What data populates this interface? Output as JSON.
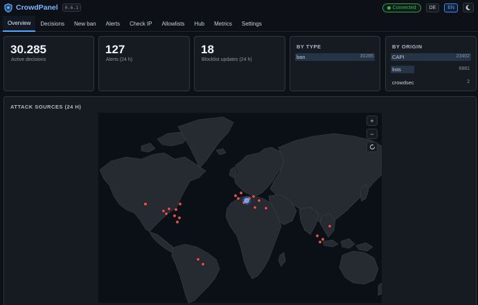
{
  "header": {
    "title": "CrowdPanel",
    "version": "0.6.1",
    "status": "Connected",
    "languages": [
      "DE",
      "EN"
    ],
    "active_language": "EN",
    "theme_icon": "moon-icon"
  },
  "tabs": [
    {
      "label": "Overview",
      "active": true
    },
    {
      "label": "Decisions"
    },
    {
      "label": "New ban"
    },
    {
      "label": "Alerts"
    },
    {
      "label": "Check IP"
    },
    {
      "label": "Allowlists"
    },
    {
      "label": "Hub"
    },
    {
      "label": "Metrics"
    },
    {
      "label": "Settings"
    }
  ],
  "stats": [
    {
      "value": "30.285",
      "label": "Active decisions"
    },
    {
      "value": "127",
      "label": "Alerts (24 h)"
    },
    {
      "value": "18",
      "label": "Blocklist updates (24 h)"
    }
  ],
  "by_type": {
    "title": "BY TYPE",
    "items": [
      {
        "label": "ban",
        "value": "30285",
        "fraction": 1.0
      }
    ]
  },
  "by_origin": {
    "title": "BY ORIGIN",
    "items": [
      {
        "label": "CAPI",
        "value": "23402",
        "fraction": 1.0
      },
      {
        "label": "lists",
        "value": "6881",
        "fraction": 0.29
      },
      {
        "label": "crowdsec",
        "value": "2",
        "fraction": 0.0
      }
    ]
  },
  "map": {
    "title": "ATTACK SOURCES (24 H)",
    "zoom_in": "+",
    "zoom_out": "−",
    "reset_icon": "reset-icon"
  },
  "colors": {
    "accent": "#58a6ff",
    "success": "#3fb950",
    "marker": "#e5534b",
    "home": "#4f80ff",
    "land": "#262a31",
    "ocean": "#0b0f16"
  }
}
